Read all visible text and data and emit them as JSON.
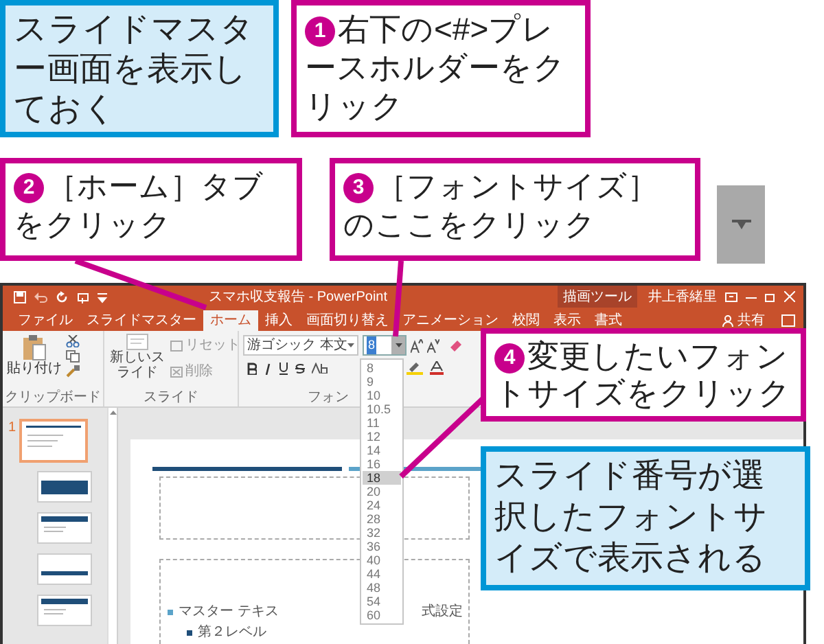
{
  "callouts": [
    {
      "kind": "note",
      "text": "スライドマスター画面を表示しておく"
    },
    {
      "kind": "step",
      "step": "1",
      "text": "右下の<#>プレースホルダーをクリック"
    },
    {
      "kind": "step",
      "step": "2",
      "text": "［ホーム］タブをクリック"
    },
    {
      "kind": "step",
      "step": "3",
      "text": "［フォントサイズ］のここをクリック"
    },
    {
      "kind": "step",
      "step": "4",
      "text": "変更したいフォントサイズをクリック"
    },
    {
      "kind": "note",
      "text": "スライド番号が選択したフォントサイズで表示される"
    }
  ],
  "window": {
    "title": "スマホ収支報告 - PowerPoint",
    "context_tab": "描画ツール",
    "user": "井上香緒里"
  },
  "tabs": [
    {
      "label": "ファイル",
      "selected": false
    },
    {
      "label": "スライドマスター",
      "selected": false
    },
    {
      "label": "ホーム",
      "selected": true
    },
    {
      "label": "挿入",
      "selected": false
    },
    {
      "label": "画面切り替え",
      "selected": false
    },
    {
      "label": "アニメーション",
      "selected": false
    },
    {
      "label": "校閲",
      "selected": false
    },
    {
      "label": "表示",
      "selected": false
    },
    {
      "label": "書式",
      "selected": false
    }
  ],
  "share": "共有",
  "ribbon": {
    "paste": "貼り付け",
    "clipboard_label": "クリップボード",
    "new_slide": "新しいスライド",
    "reset": "リセット",
    "delete": "削除",
    "slide_label": "スライド",
    "font_name": "游ゴシック 本文",
    "font_size": "8",
    "font_label": "フォン"
  },
  "font_sizes": [
    {
      "value": "8",
      "selected": false
    },
    {
      "value": "9",
      "selected": false
    },
    {
      "value": "10",
      "selected": false
    },
    {
      "value": "10.5",
      "selected": false
    },
    {
      "value": "11",
      "selected": false
    },
    {
      "value": "12",
      "selected": false
    },
    {
      "value": "14",
      "selected": false
    },
    {
      "value": "16",
      "selected": false
    },
    {
      "value": "18",
      "selected": true
    },
    {
      "value": "20",
      "selected": false
    },
    {
      "value": "24",
      "selected": false
    },
    {
      "value": "28",
      "selected": false
    },
    {
      "value": "32",
      "selected": false
    },
    {
      "value": "36",
      "selected": false
    },
    {
      "value": "40",
      "selected": false
    },
    {
      "value": "44",
      "selected": false
    },
    {
      "value": "48",
      "selected": false
    },
    {
      "value": "54",
      "selected": false
    },
    {
      "value": "60",
      "selected": false
    }
  ],
  "thumbnails": [
    {
      "number": "1",
      "kind": "master",
      "selected": true
    },
    {
      "kind": "band",
      "selected": false
    },
    {
      "kind": "header",
      "selected": false
    },
    {
      "kind": "plain",
      "selected": false
    },
    {
      "kind": "header",
      "selected": false
    }
  ],
  "slide": {
    "body_text_left": "マスター テキス",
    "body_text_right": "式設定",
    "level2_text": "第２レベル"
  }
}
